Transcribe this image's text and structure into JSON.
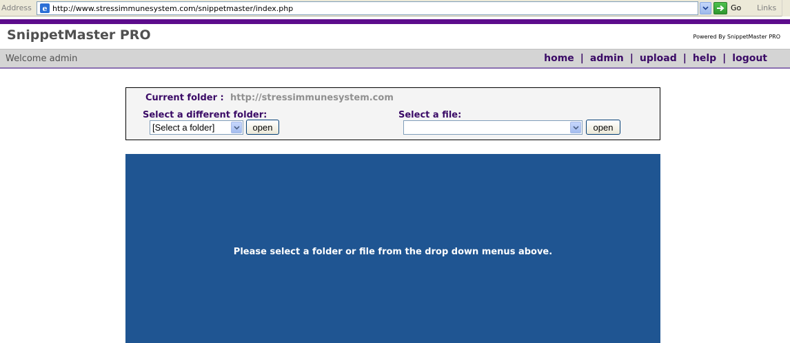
{
  "browser": {
    "address_label": "Address",
    "url": "http://www.stressimmunesystem.com/snippetmaster/index.php",
    "go_label": "Go",
    "links_label": "Links"
  },
  "app": {
    "title": "SnippetMaster PRO",
    "powered_by": "Powered By SnippetMaster PRO",
    "welcome": "Welcome admin",
    "nav": [
      "home",
      "admin",
      "upload",
      "help",
      "logout"
    ]
  },
  "panel": {
    "current_folder_label": "Current folder :",
    "current_folder_value": "http://stressimmunesystem.com",
    "folder_label": "Select a different folder:",
    "folder_selected": "[Select a folder]",
    "folder_open_label": "open",
    "file_label": "Select a file:",
    "file_selected": "",
    "file_open_label": "open"
  },
  "message": "Please select a folder or file from the drop down menus above.",
  "colors": {
    "brand_purple": "#5c0c8c",
    "nav_text": "#3a0a66",
    "message_bg": "#1f5592"
  }
}
